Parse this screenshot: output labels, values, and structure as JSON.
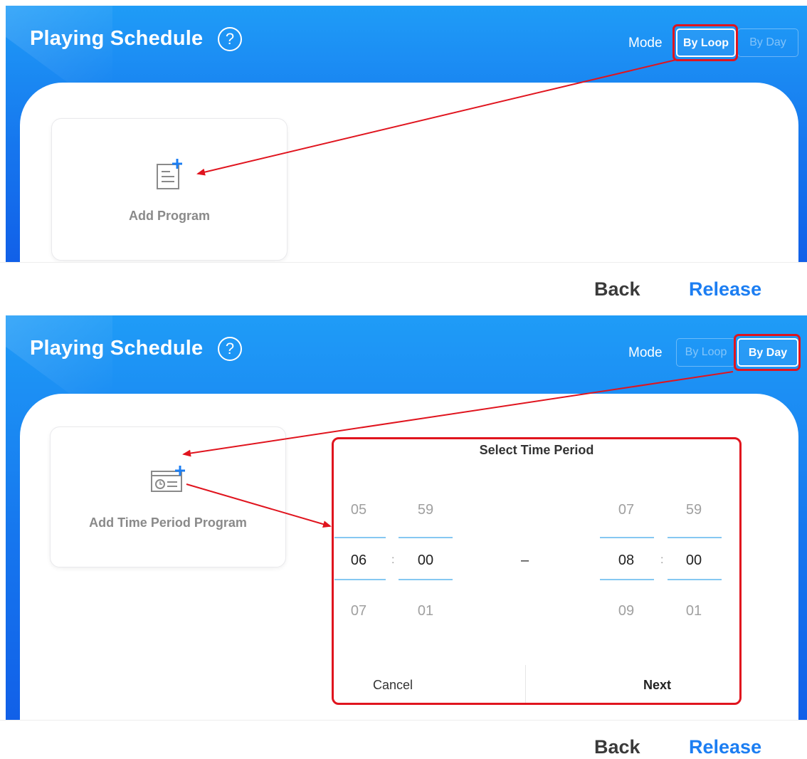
{
  "panel1": {
    "title": "Playing Schedule",
    "help_icon": "question-circle-icon",
    "mode_label": "Mode",
    "mode_loop": "By Loop",
    "mode_day": "By Day",
    "card_label": "Add Program",
    "card_icon": "add-document-icon",
    "back": "Back",
    "release": "Release"
  },
  "panel2": {
    "title": "Playing Schedule",
    "help_icon": "question-circle-icon",
    "mode_label": "Mode",
    "mode_loop": "By Loop",
    "mode_day": "By Day",
    "card_label": "Add Time Period Program",
    "card_icon": "add-time-period-icon",
    "back": "Back",
    "release": "Release"
  },
  "dialog": {
    "title": "Select Time Period",
    "start_hour": {
      "prev": "05",
      "selected": "06",
      "next": "07"
    },
    "start_minute": {
      "prev": "59",
      "selected": "00",
      "next": "01"
    },
    "end_hour": {
      "prev": "07",
      "selected": "08",
      "next": "09"
    },
    "end_minute": {
      "prev": "59",
      "selected": "00",
      "next": "01"
    },
    "separator": ":",
    "range_dash": "–",
    "cancel": "Cancel",
    "next": "Next"
  },
  "colors": {
    "accent": "#1c7ef2",
    "highlight_red": "#e0141e",
    "header_blue": "#1676ee"
  }
}
